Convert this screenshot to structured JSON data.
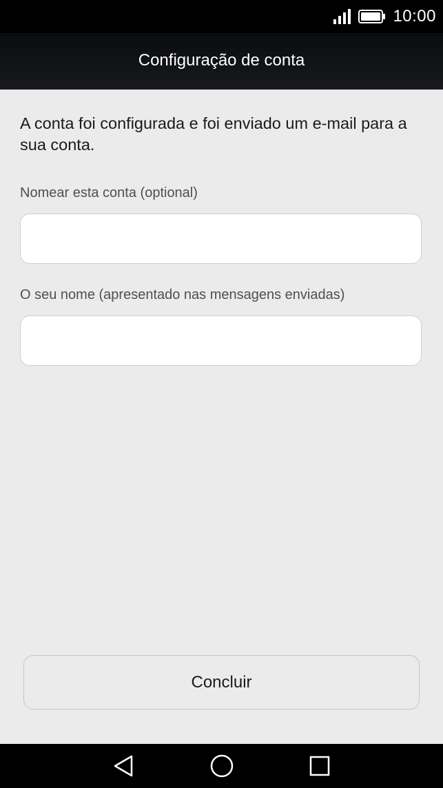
{
  "status_bar": {
    "time": "10:00",
    "icons": [
      "signal-icon",
      "battery-icon"
    ]
  },
  "app_bar": {
    "title": "Configuração de conta"
  },
  "main": {
    "message": "A conta foi configurada e foi enviado um e-mail para a sua conta.",
    "fields": [
      {
        "label": "Nomear esta conta (optional)",
        "value": "",
        "placeholder": ""
      },
      {
        "label": "O seu nome (apresentado nas mensagens enviadas)",
        "value": "",
        "placeholder": ""
      }
    ],
    "done_label": "Concluir"
  },
  "nav_bar": {
    "icons": [
      "back-icon",
      "home-icon",
      "recents-icon"
    ]
  },
  "colors": {
    "background": "#ebebeb",
    "bars": "#000000",
    "field_border": "#cfcfcf"
  }
}
